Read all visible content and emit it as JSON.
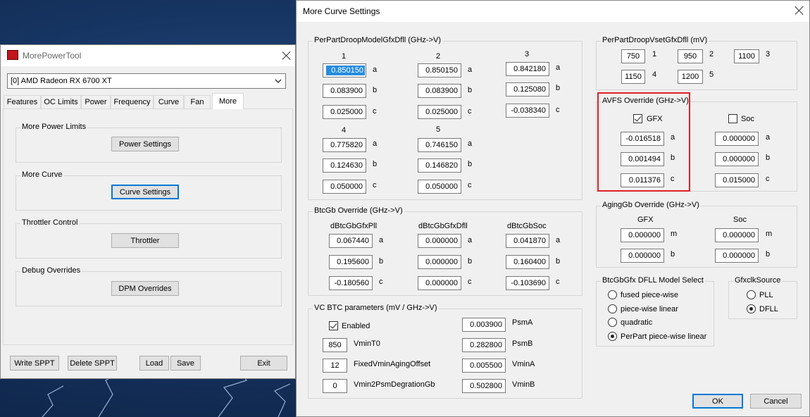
{
  "colors": {
    "highlight_box": "#e0202a",
    "selection": "#0078d7",
    "accent": "#0078d7"
  },
  "main_window": {
    "title": "MorePowerTool",
    "device_select": "[0] AMD Radeon RX 6700 XT",
    "tabs": [
      "Features",
      "OC Limits",
      "Power",
      "Frequency",
      "Curve",
      "Fan",
      "More"
    ],
    "groups": {
      "more_power_limits": {
        "label": "More Power Limits",
        "button": "Power Settings"
      },
      "more_curve": {
        "label": "More Curve",
        "button": "Curve Settings"
      },
      "throttler_control": {
        "label": "Throttler Control",
        "button": "Throttler"
      },
      "debug_overrides": {
        "label": "Debug Overrides",
        "button": "DPM Overrides"
      }
    },
    "bottom_buttons": {
      "write": "Write SPPT",
      "delete": "Delete SPPT",
      "load": "Load",
      "save": "Save",
      "exit": "Exit"
    }
  },
  "dialog": {
    "title": "More Curve Settings",
    "droop_model": {
      "label": "PerPartDroopModelGfxDfll (GHz->V)",
      "headers": [
        "1",
        "2",
        "3",
        "4",
        "5"
      ],
      "coef_labels": [
        "a",
        "b",
        "c"
      ],
      "values": [
        [
          "0.850150",
          "0.083900",
          "0.025000"
        ],
        [
          "0.850150",
          "0.083900",
          "0.025000"
        ],
        [
          "0.842180",
          "0.125080",
          "-0.038340"
        ],
        [
          "0.775820",
          "0.124630",
          "0.050000"
        ],
        [
          "0.746150",
          "0.146820",
          "0.050000"
        ]
      ]
    },
    "btcgb": {
      "label": "BtcGb Override (GHz->V)",
      "headers": [
        "dBtcGbGfxPll",
        "dBtcGbGfxDfll",
        "dBtcGbSoc"
      ],
      "coef_labels": [
        "a",
        "b",
        "c"
      ],
      "values": [
        [
          "0.067440",
          "0.195600",
          "-0.180560"
        ],
        [
          "0.000000",
          "0.000000",
          "0.000000"
        ],
        [
          "0.041870",
          "0.160400",
          "-0.103690"
        ]
      ]
    },
    "vc_btc": {
      "label": "VC BTC parameters (mV / GHz->V)",
      "enabled_label": "Enabled",
      "enabled": true,
      "left": [
        {
          "value": "850",
          "label": "VminT0"
        },
        {
          "value": "12",
          "label": "FixedVminAgingOffset"
        },
        {
          "value": "0",
          "label": "Vmin2PsmDegrationGb"
        }
      ],
      "right": [
        {
          "value": "0.003900",
          "label": "PsmA"
        },
        {
          "value": "0.282800",
          "label": "PsmB"
        },
        {
          "value": "0.005500",
          "label": "VminA"
        },
        {
          "value": "0.502800",
          "label": "VminB"
        }
      ]
    },
    "vset": {
      "label": "PerPartDroopVsetGfxDfll (mV)",
      "items": [
        {
          "value": "750",
          "label": "1"
        },
        {
          "value": "950",
          "label": "2"
        },
        {
          "value": "1100",
          "label": "3"
        },
        {
          "value": "1150",
          "label": "4"
        },
        {
          "value": "1200",
          "label": "5"
        }
      ]
    },
    "avfs": {
      "label": "AVFS Override (GHz->V)",
      "gfx_label": "GFX",
      "gfx_checked": true,
      "soc_label": "Soc",
      "soc_checked": false,
      "coef_labels": [
        "a",
        "b",
        "c"
      ],
      "gfx_values": [
        "-0.016518",
        "0.001494",
        "0.011376"
      ],
      "soc_values": [
        "0.000000",
        "0.000000",
        "0.015000"
      ]
    },
    "aging": {
      "label": "AgingGb Override (GHz->V)",
      "gfx_label": "GFX",
      "soc_label": "Soc",
      "coef_labels": [
        "m",
        "b"
      ],
      "gfx_values": [
        "0.000000",
        "0.000000"
      ],
      "soc_values": [
        "0.000000",
        "0.000000"
      ]
    },
    "dfll_model": {
      "label": "BtcGbGfx DFLL Model Select",
      "options": [
        "fused piece-wise",
        "piece-wise linear",
        "quadratic",
        "PerPart piece-wise linear"
      ],
      "selected": 3
    },
    "clk_source": {
      "label": "GfxclkSource",
      "options": [
        "PLL",
        "DFLL"
      ],
      "selected": 1
    },
    "ok": "OK",
    "cancel": "Cancel"
  }
}
